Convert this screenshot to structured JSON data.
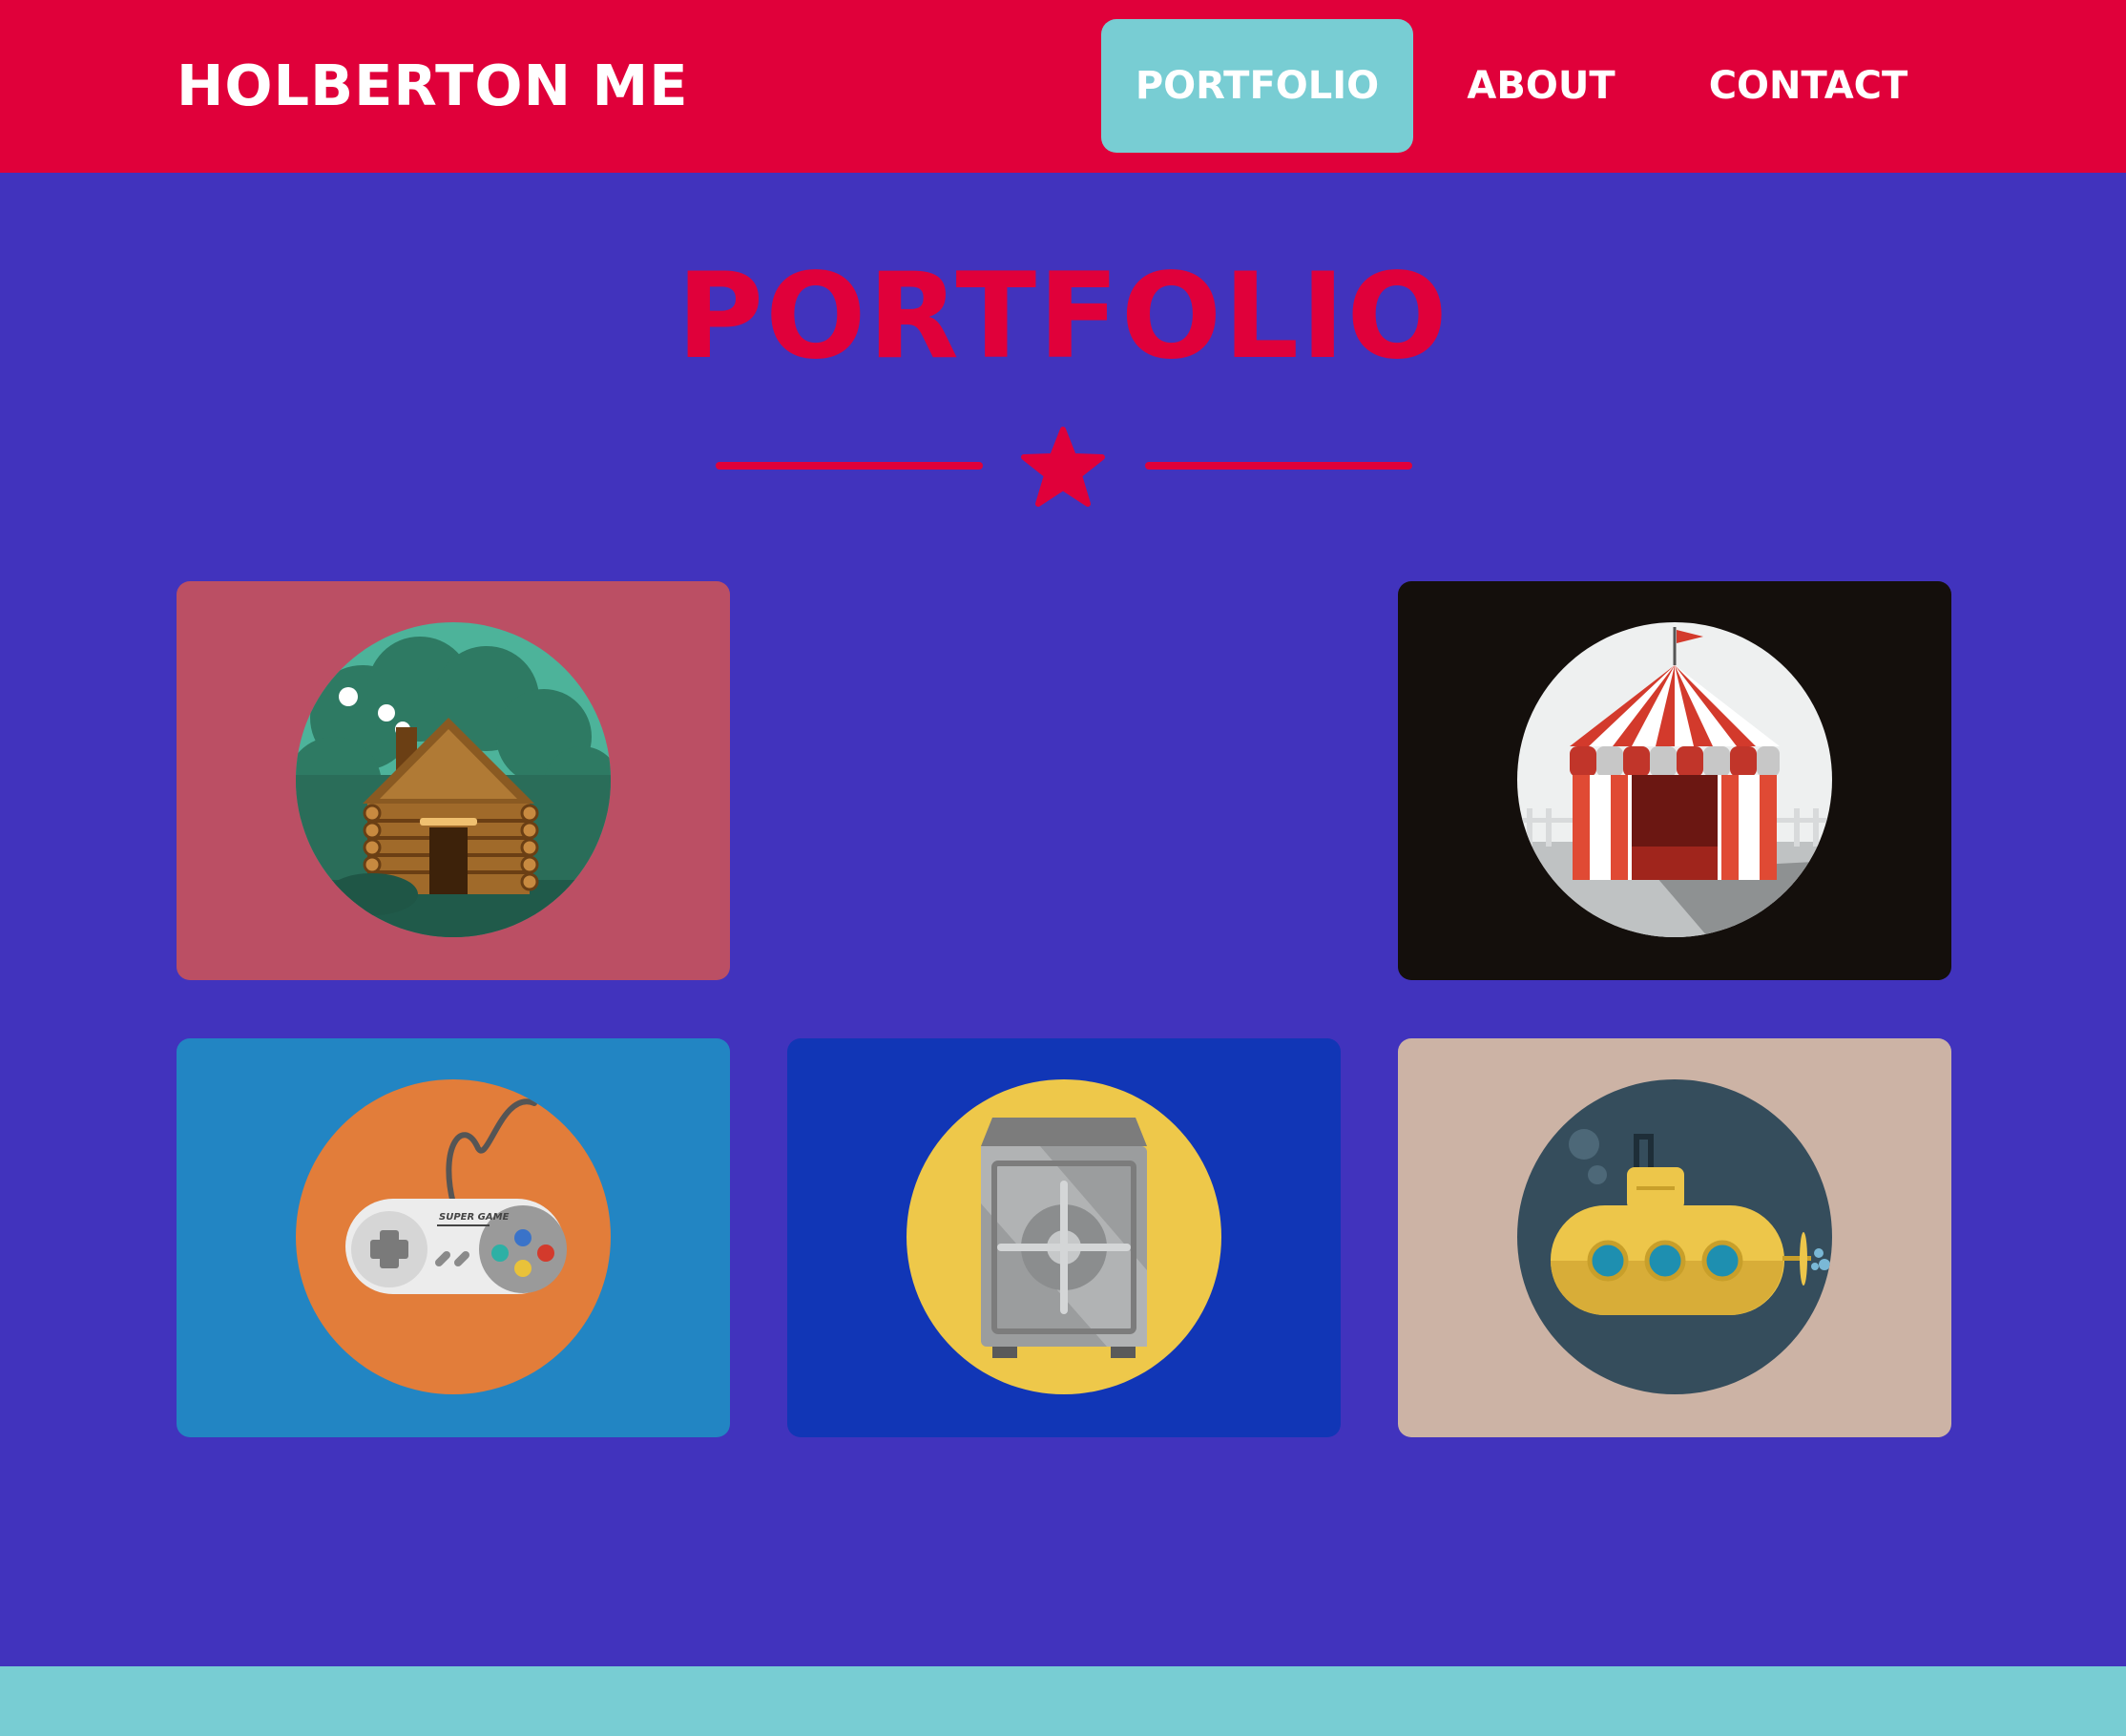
{
  "header": {
    "brand": "HOLBERTON ME",
    "nav": {
      "portfolio": "PORTFOLIO",
      "about": "ABOUT",
      "contact": "CONTACT"
    }
  },
  "main": {
    "title": "PORTFOLIO",
    "cards": [
      {
        "icon": "log-cabin-icon",
        "bg": "#bb4f64"
      },
      {
        "icon": "circus-tent-icon",
        "bg": "#140f0c"
      },
      {
        "icon": "game-controller-icon",
        "bg": "#2285c3",
        "controller_label": "SUPER GAME"
      },
      {
        "icon": "safe-icon",
        "bg": "#1136b6"
      },
      {
        "icon": "submarine-icon",
        "bg": "#ccb3a5"
      }
    ]
  },
  "colors": {
    "background": "#4133bd",
    "accent": "#e0003a",
    "highlight": "#78cdd3"
  }
}
